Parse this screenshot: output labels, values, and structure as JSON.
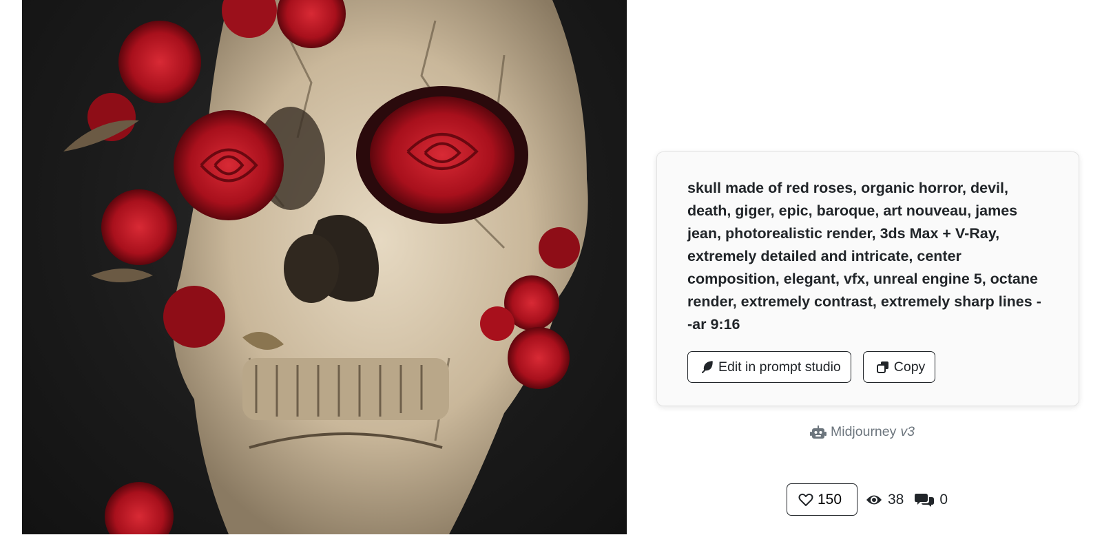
{
  "artwork": {
    "alt_icon": "skull-rose-artwork-image",
    "colors": {
      "background": "#1b1b1b",
      "bone": "#d9cbb4",
      "rose": "#b3121f"
    }
  },
  "prompt": {
    "text": "skull made of red roses, organic horror, devil, death, giger, epic, baroque, art nouveau, james jean, photorealistic render, 3ds Max + V-Ray, extremely detailed and intricate, center composition, elegant, vfx, unreal engine 5, octane render, extremely contrast, extremely sharp lines --ar 9:16"
  },
  "actions": {
    "edit_label": "Edit in prompt studio",
    "edit_icon": "feather-icon",
    "copy_label": "Copy",
    "copy_icon": "copy-icon"
  },
  "model": {
    "icon": "robot-icon",
    "name": "Midjourney",
    "version": "v3"
  },
  "stats": {
    "likes": "150",
    "views": "38",
    "comments": "0",
    "like_icon": "heart-icon",
    "view_icon": "eye-icon",
    "comment_icon": "comments-icon"
  }
}
